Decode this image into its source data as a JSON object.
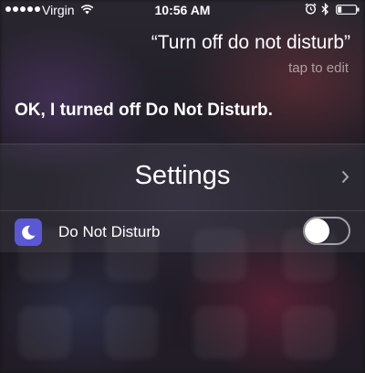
{
  "status_bar": {
    "carrier": "Virgin",
    "time": "10:56 AM",
    "icons": [
      "signal-dots-icon",
      "wifi-icon",
      "alarm-icon",
      "bluetooth-icon",
      "battery-icon"
    ]
  },
  "siri": {
    "spoken_text": "“Turn off do not disturb”",
    "tap_to_edit": "tap to edit",
    "response": "OK, I turned off Do Not Disturb."
  },
  "card": {
    "title": "Settings",
    "title_icon": "chevron-right-icon",
    "setting_label": "Do Not Disturb",
    "setting_icon": "moon-icon",
    "toggle_on": false
  },
  "colors": {
    "moon_tile": "#5b58d6",
    "text": "#ffffff"
  }
}
